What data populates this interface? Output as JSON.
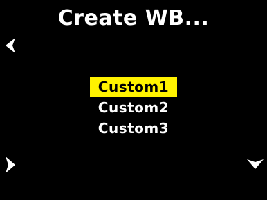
{
  "screen": {
    "title": "Create WB..."
  },
  "menu": {
    "items": [
      {
        "label": "Custom1",
        "selected": true
      },
      {
        "label": "Custom2",
        "selected": false
      },
      {
        "label": "Custom3",
        "selected": false
      }
    ]
  },
  "nav": {
    "left_icon": "chevron-left-icon",
    "right_icon": "chevron-right-icon",
    "down_icon": "chevron-down-icon"
  },
  "colors": {
    "background": "#000000",
    "text": "#ffffff",
    "highlight": "#fff200",
    "highlight_text": "#000000"
  }
}
